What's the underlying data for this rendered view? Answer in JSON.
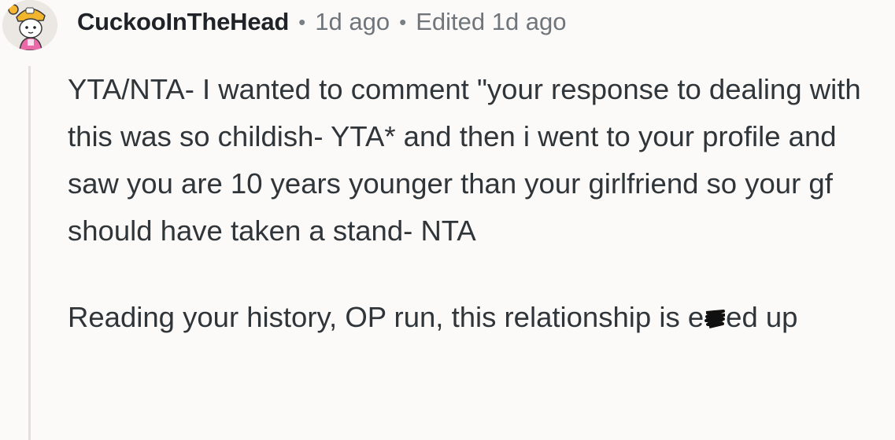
{
  "comment": {
    "username": "CuckooInTheHead",
    "separator": "•",
    "time": "1d ago",
    "edited": "Edited 1d ago",
    "paragraph_1": "YTA/NTA- I wanted to comment \"your response to dealing with this was so childish- YTA* and then i went to your profile and saw you are 10 years younger than your girlfriend so your gf should have taken a stand- NTA",
    "paragraph_2_start": "Reading your history, OP run, this relationship is e",
    "paragraph_2_end": "ed up"
  },
  "colors": {
    "background": "#fbfaf8",
    "thread_line": "#e3dfdb",
    "username": "#1f2328",
    "meta": "#6f757a",
    "body_text": "#30353a"
  },
  "icons": {
    "avatar": "avatar-character-icon",
    "censor": "censor-scribble-icon"
  }
}
